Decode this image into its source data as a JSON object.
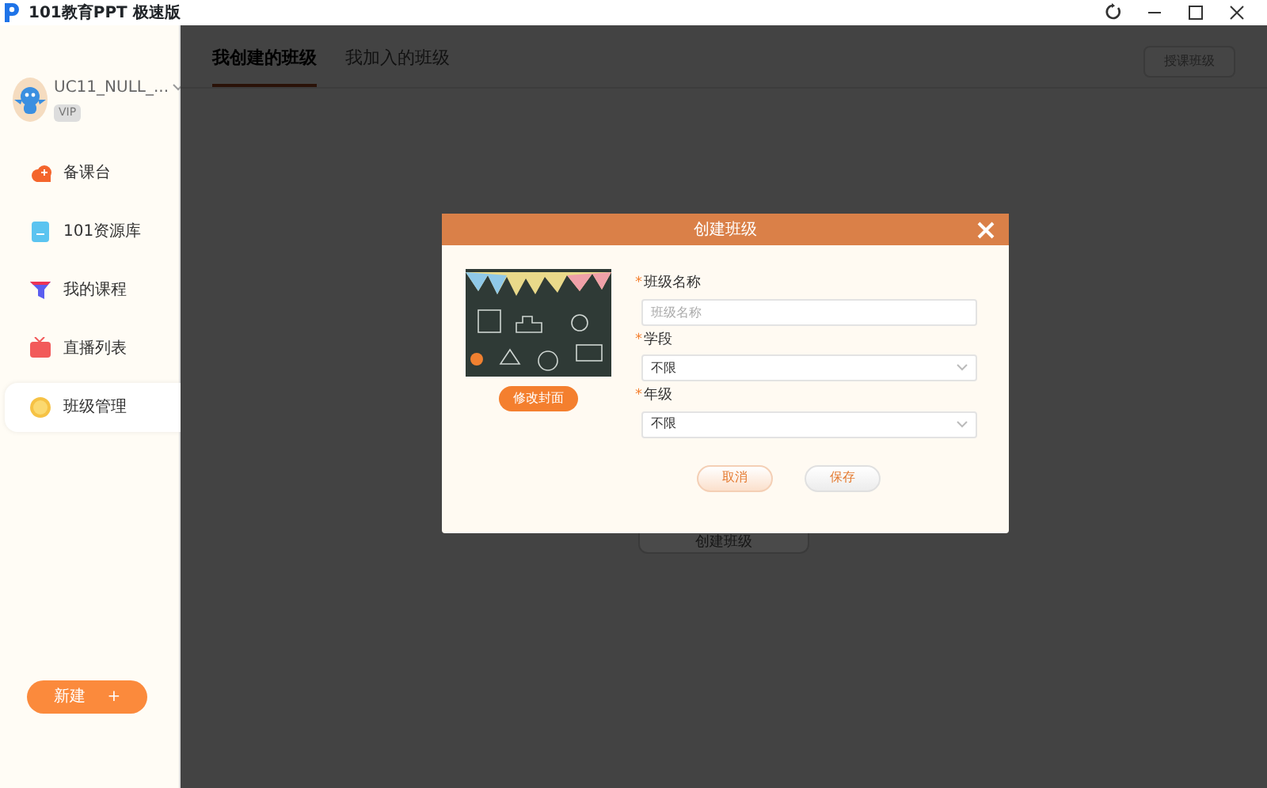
{
  "window": {
    "title": "101教育PPT 极速版"
  },
  "user": {
    "name": "UC11_NULL_...",
    "badge": "VIP"
  },
  "sidebar": {
    "items": [
      {
        "label": "备课台",
        "selected": false
      },
      {
        "label": "101资源库",
        "selected": false
      },
      {
        "label": "我的课程",
        "selected": false
      },
      {
        "label": "直播列表",
        "selected": false
      },
      {
        "label": "班级管理",
        "selected": true
      }
    ],
    "new_button": {
      "label": "新建",
      "icon": "+"
    }
  },
  "tabs": [
    {
      "label": "我创建的班级",
      "selected": true
    },
    {
      "label": "我加入的班级",
      "selected": false
    }
  ],
  "top_button": "授课班级",
  "background_button": "创建班级",
  "dialog": {
    "title": "创建班级",
    "change_cover": "修改封面",
    "fields": [
      {
        "kind": "text",
        "required_mark": "*",
        "label": "班级名称",
        "placeholder": "班级名称"
      },
      {
        "kind": "select",
        "required_mark": "*",
        "label": "学段",
        "value": "不限"
      },
      {
        "kind": "select",
        "required_mark": "*",
        "label": "年级",
        "value": "不限"
      }
    ],
    "buttons": [
      "取消",
      "保存"
    ]
  }
}
